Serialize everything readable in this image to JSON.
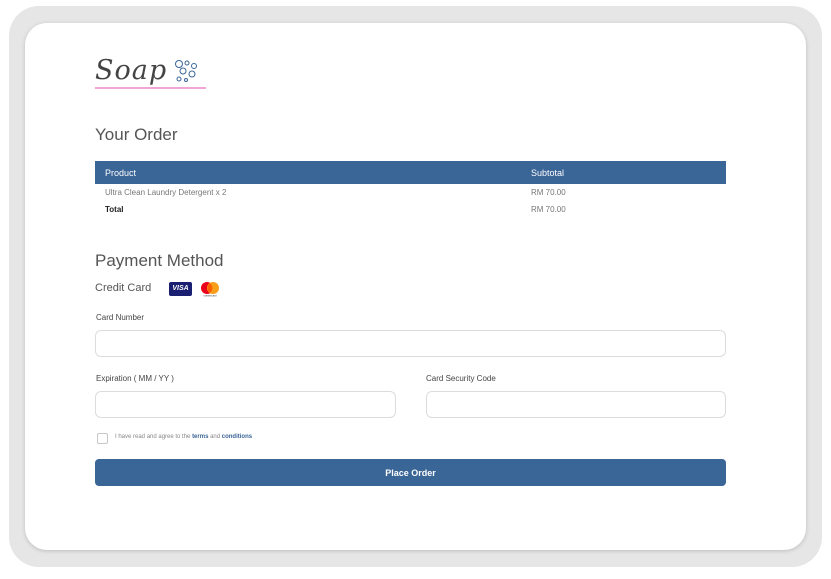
{
  "brand": {
    "logo_text": "Soap"
  },
  "order": {
    "title": "Your Order",
    "headers": {
      "product": "Product",
      "subtotal": "Subtotal"
    },
    "items": [
      {
        "product": "Ultra Clean Laundry Detergent x 2",
        "subtotal": "RM 70.00"
      }
    ],
    "total": {
      "label": "Total",
      "value": "RM 70.00"
    }
  },
  "payment": {
    "title": "Payment Method",
    "method_label": "Credit Card",
    "card_brands": [
      "VISA",
      "mastercard"
    ],
    "card_number": {
      "label": "Card Number",
      "value": "",
      "placeholder": ""
    },
    "expiration": {
      "label": "Expiration ( MM / YY )",
      "value": "",
      "placeholder": ""
    },
    "security_code": {
      "label": "Card Security Code",
      "value": "",
      "placeholder": ""
    }
  },
  "agreement": {
    "text_before": "I have read and agree to the",
    "terms_link": "terms",
    "and": "and",
    "conditions_link": "conditions",
    "checked": false
  },
  "actions": {
    "place_order": "Place Order"
  },
  "colors": {
    "primary": "#3a6597",
    "logo_underline": "#f0a6d6",
    "frame": "#e6e6e6"
  },
  "icons": [
    "bubbles-icon",
    "visa-icon",
    "mastercard-icon"
  ]
}
